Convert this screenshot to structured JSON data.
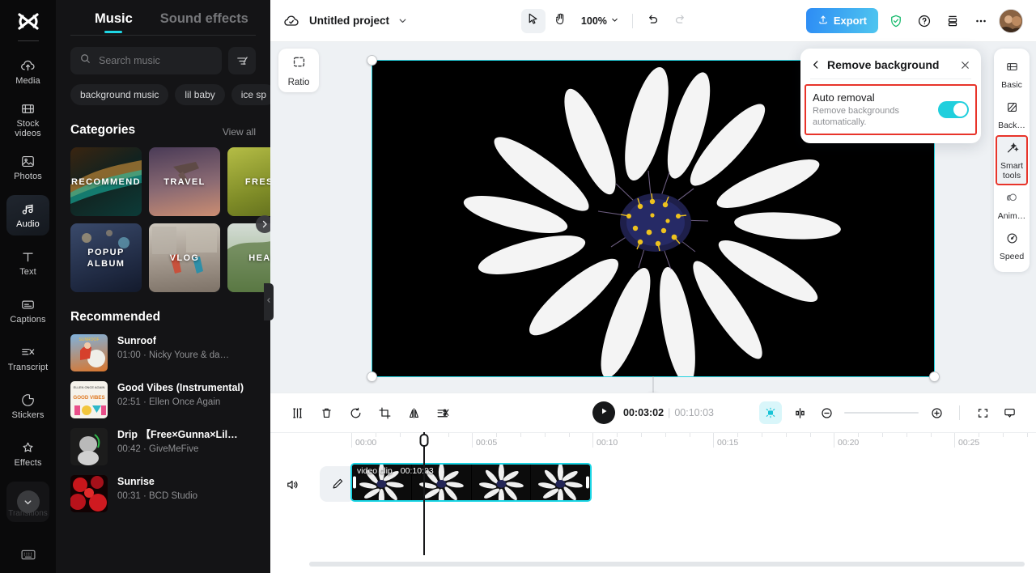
{
  "rail": {
    "logo_icon": "capcut-logo-icon",
    "items": [
      {
        "icon": "cloud-upload-icon",
        "label": "Media",
        "active": false
      },
      {
        "icon": "film-strip-icon",
        "label": "Stock videos",
        "active": false
      },
      {
        "icon": "photo-icon",
        "label": "Photos",
        "active": false
      },
      {
        "icon": "music-note-icon",
        "label": "Audio",
        "active": true
      },
      {
        "icon": "text-t-icon",
        "label": "Text",
        "active": false
      },
      {
        "icon": "captions-icon",
        "label": "Captions",
        "active": false
      },
      {
        "icon": "transcript-icon",
        "label": "Transcript",
        "active": false
      },
      {
        "icon": "sticker-icon",
        "label": "Stickers",
        "active": false
      },
      {
        "icon": "sparkle-effects-icon",
        "label": "Effects",
        "active": false
      }
    ],
    "more_label": "Transitions",
    "more_icon": "chevron-down-icon",
    "keyboard_icon": "keyboard-icon"
  },
  "panel": {
    "tabs": [
      {
        "label": "Music",
        "active": true
      },
      {
        "label": "Sound effects",
        "active": false
      }
    ],
    "search": {
      "placeholder": "Search music",
      "value": "",
      "icon": "search-icon"
    },
    "filter_icon": "filter-icon",
    "chips": [
      "background music",
      "lil baby",
      "ice sp"
    ],
    "categories_title": "Categories",
    "view_all": "View all",
    "categories": [
      {
        "label": "RECOMMEND",
        "color_a": "#3a2410",
        "color_b": "#0c3b38"
      },
      {
        "label": "TRAVEL",
        "color_a": "#4a3b57",
        "color_b": "#c98a74"
      },
      {
        "label": "FRESH",
        "color_a": "#a8b23f",
        "color_b": "#6d7a22"
      },
      {
        "label": "POPUP ALBUM",
        "color_a": "#2b3550",
        "color_b": "#1b2338"
      },
      {
        "label": "VLOG",
        "color_a": "#b9b2a8",
        "color_b": "#8d7f72"
      },
      {
        "label": "HEAL",
        "color_a": "#cfd8d0",
        "color_b": "#4a6b3d"
      }
    ],
    "next_arrow_icon": "chevron-right-icon",
    "recommended_title": "Recommended",
    "tracks": [
      {
        "name": "Sunroof",
        "sub": "01:00 · Nicky Youre & da…",
        "art_a": "#6fa7d8",
        "art_b": "#e0762c"
      },
      {
        "name": "Good Vibes (Instrumental)",
        "sub": "02:51 · Ellen Once Again",
        "art_a": "#f7f4ee",
        "art_b": "#e6e0d4"
      },
      {
        "name": "Drip 【Free×Gunna×Lil…",
        "sub": "00:42 · GiveMeFive",
        "art_a": "#2a2a2a",
        "art_b": "#111111"
      },
      {
        "name": "Sunrise",
        "sub": "00:31 · BCD Studio",
        "art_a": "#c3161b",
        "art_b": "#5d0408"
      }
    ],
    "collapse_icon": "chevron-left-icon"
  },
  "header": {
    "cloud_icon": "cloud-check-icon",
    "project_title": "Untitled project",
    "title_chevron_icon": "chevron-down-icon",
    "tools": [
      {
        "icon": "cursor-arrow-icon",
        "name": "select-tool",
        "selected": true
      },
      {
        "icon": "hand-icon",
        "name": "pan-tool",
        "selected": false
      }
    ],
    "zoom_level": "100%",
    "zoom_chevron_icon": "chevron-down-icon",
    "undo_icon": "undo-icon",
    "redo_icon": "redo-icon",
    "export_label": "Export",
    "export_icon": "upload-icon",
    "export_color": "#2d8cf5",
    "shield_icon": "shield-check-icon",
    "shield_color": "#13b96a",
    "help_icon": "question-circle-icon",
    "layers_icon": "stack-icon",
    "more_icon": "ellipsis-icon",
    "avatar_name": "user-avatar"
  },
  "canvas": {
    "ratio_label": "Ratio",
    "ratio_icon": "aspect-ratio-icon",
    "selection_color": "#24d3e0",
    "rotate_icon": "rotate-icon"
  },
  "remove_bg": {
    "back_icon": "chevron-left-icon",
    "title": "Remove background",
    "close_icon": "close-icon",
    "option_label": "Auto removal",
    "option_desc": "Remove backgrounds automatically.",
    "toggle_on": true,
    "toggle_color": "#20cfdd",
    "highlight_color": "#e8342a"
  },
  "tool_strip": {
    "items": [
      {
        "icon": "basic-frame-icon",
        "label": "Basic",
        "selected": false
      },
      {
        "icon": "background-icon",
        "label": "Back…",
        "selected": false
      },
      {
        "icon": "magic-wand-icon",
        "label": "Smart tools",
        "selected": true
      },
      {
        "icon": "animation-icon",
        "label": "Anim…",
        "selected": false
      },
      {
        "icon": "speed-gauge-icon",
        "label": "Speed",
        "selected": false
      }
    ],
    "highlight_color": "#e8342a"
  },
  "timeline": {
    "tools": [
      {
        "icon": "split-icon",
        "name": "split-tool"
      },
      {
        "icon": "trash-icon",
        "name": "delete-tool"
      },
      {
        "icon": "freeze-icon",
        "name": "freeze-tool"
      },
      {
        "icon": "crop-icon",
        "name": "crop-tool"
      },
      {
        "icon": "mirror-icon",
        "name": "mirror-tool"
      },
      {
        "icon": "cut-transcript-icon",
        "name": "cut-tool"
      }
    ],
    "play_icon": "play-icon",
    "current_time": "00:03:02",
    "time_sep": "|",
    "duration": "00:10:03",
    "magnet_icon": "magnet-icon",
    "magnet_color": "#d9f6fa",
    "split-view_icon": "split-view-icon",
    "zoom_out_icon": "minus-circle-icon",
    "zoom_in_icon": "plus-circle-icon",
    "fit_icon": "fit-screen-icon",
    "preview_icon": "preview-icon",
    "ruler_ticks": [
      "00:00",
      "00:05",
      "00:10",
      "00:15",
      "00:20",
      "00:25"
    ],
    "mute_icon": "speaker-icon",
    "edit_icon": "pencil-icon",
    "clip": {
      "title": "video clip",
      "duration": "00:10:03",
      "selected": true,
      "color": "#18d4e4"
    }
  }
}
